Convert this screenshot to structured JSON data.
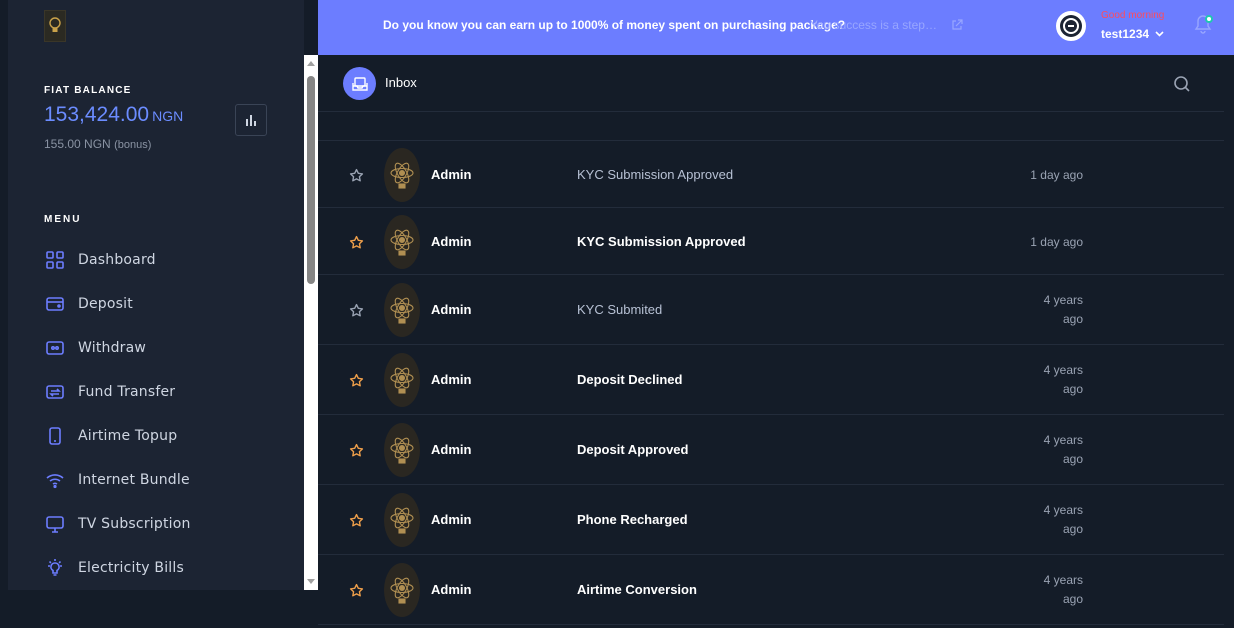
{
  "sidebar": {
    "balance_label": "FIAT BALANCE",
    "balance_amount": "153,424.00",
    "balance_currency": "NGN",
    "bonus_amount": "155.00",
    "bonus_currency": "NGN",
    "bonus_label": "(bonus)",
    "menu_label": "MENU",
    "menu": [
      {
        "label": "Dashboard",
        "icon": "dashboard-icon"
      },
      {
        "label": "Deposit",
        "icon": "wallet-icon"
      },
      {
        "label": "Withdraw",
        "icon": "cash-icon"
      },
      {
        "label": "Fund Transfer",
        "icon": "transfer-icon"
      },
      {
        "label": "Airtime Topup",
        "icon": "phone-icon"
      },
      {
        "label": "Internet Bundle",
        "icon": "wifi-icon"
      },
      {
        "label": "TV Subscription",
        "icon": "tv-icon"
      },
      {
        "label": "Electricity Bills",
        "icon": "bulb-icon"
      }
    ]
  },
  "header": {
    "promo": "Do you know you can earn up to 1000% of money spent on purchasing package?",
    "promo_sub": "You success is a step a…",
    "greeting": "Good morning",
    "username": "test1234"
  },
  "inbox": {
    "title": "Inbox",
    "messages": [
      {
        "sender": "Admin",
        "subject": "KYC Submission Approved",
        "time": [
          "1 day ago"
        ],
        "starred": false,
        "read": true
      },
      {
        "sender": "Admin",
        "subject": "KYC Submission Approved",
        "time": [
          "1 day ago"
        ],
        "starred": true,
        "read": false
      },
      {
        "sender": "Admin",
        "subject": "KYC Submited",
        "time": [
          "4 years",
          "ago"
        ],
        "starred": false,
        "read": true
      },
      {
        "sender": "Admin",
        "subject": "Deposit Declined",
        "time": [
          "4 years",
          "ago"
        ],
        "starred": true,
        "read": false
      },
      {
        "sender": "Admin",
        "subject": "Deposit Approved",
        "time": [
          "4 years",
          "ago"
        ],
        "starred": true,
        "read": false
      },
      {
        "sender": "Admin",
        "subject": "Phone Recharged",
        "time": [
          "4 years",
          "ago"
        ],
        "starred": true,
        "read": false
      },
      {
        "sender": "Admin",
        "subject": "Airtime Conversion",
        "time": [
          "4 years",
          "ago"
        ],
        "starred": true,
        "read": false
      }
    ]
  },
  "colors": {
    "accent": "#6c7dff",
    "star_active": "#f0a04b",
    "star_inactive": "#9aa3b3"
  }
}
